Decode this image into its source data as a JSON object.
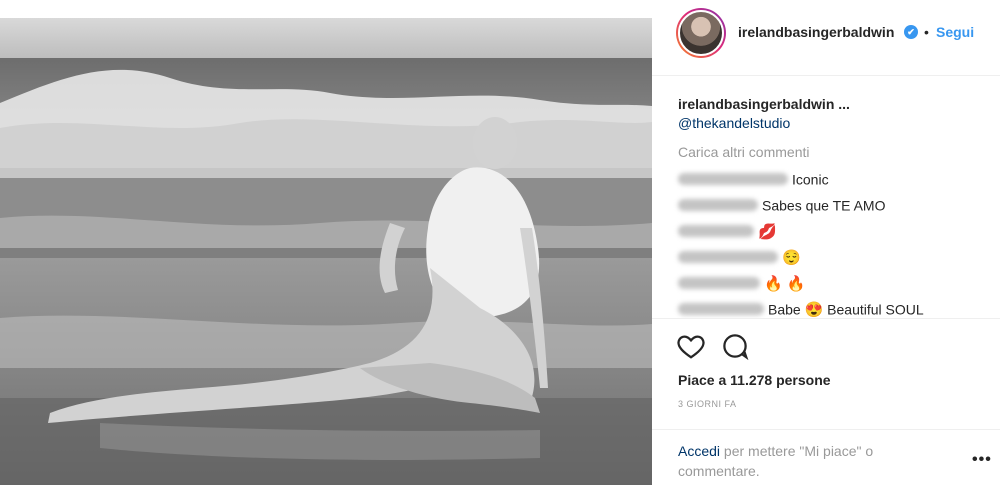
{
  "post": {
    "username": "irelandbasingerbaldwin",
    "follow_label": "Segui",
    "dot": "•",
    "verified_glyph": "✔",
    "caption_user": "irelandbasingerbaldwin ...",
    "caption_mention": "@thekandelstudio",
    "load_more": "Carica altri commenti",
    "comments": [
      {
        "text": "Iconic",
        "emoji": ""
      },
      {
        "text": "Sabes que TE AMO",
        "emoji": ""
      },
      {
        "text": "",
        "emoji": "💋"
      },
      {
        "text": "",
        "emoji": "😌"
      },
      {
        "text": "",
        "emoji": "🔥 🔥"
      },
      {
        "text": "Babe",
        "emoji": "😍",
        "text_after": "Beautiful SOUL"
      }
    ],
    "likes": "Piace a 11.278 persone",
    "time_ago": "3 GIORNI FA",
    "login_link": "Accedi",
    "login_rest": " per mettere \"Mi piace\" o commentare.",
    "more_glyph": "•••"
  }
}
